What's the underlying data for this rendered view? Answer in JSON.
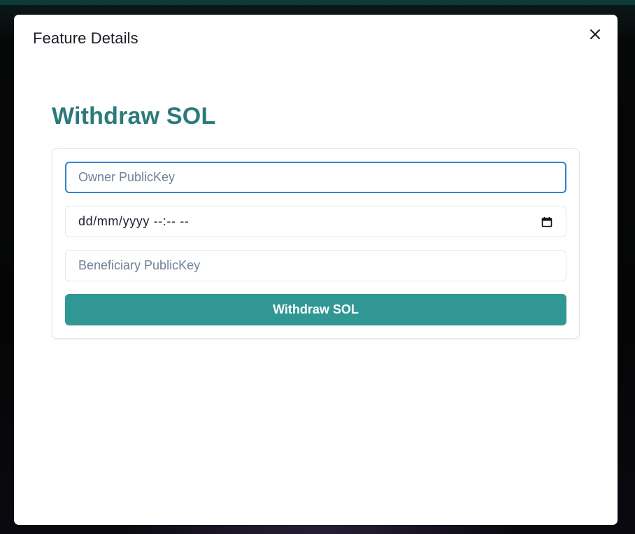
{
  "modal": {
    "title": "Feature Details",
    "close_icon": "close-icon"
  },
  "page": {
    "heading": "Withdraw SOL"
  },
  "form": {
    "owner_field": {
      "placeholder": "Owner PublicKey",
      "value": ""
    },
    "datetime_field": {
      "placeholder": "dd/mm/yyyy --:-- --",
      "icon": "calendar-icon"
    },
    "beneficiary_field": {
      "placeholder": "Beneficiary PublicKey",
      "value": ""
    },
    "submit_label": "Withdraw SOL"
  },
  "colors": {
    "heading": "#2c7a7b",
    "button": "#319795",
    "focus_ring": "#3182ce",
    "placeholder": "#718096"
  }
}
